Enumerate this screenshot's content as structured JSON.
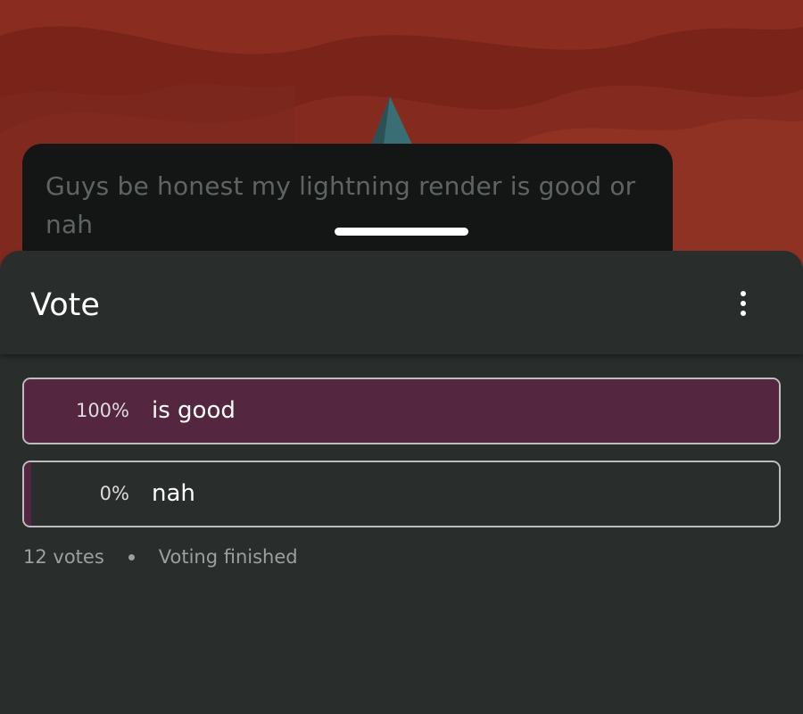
{
  "post": {
    "text": "Guys be honest my lightning render is good or nah"
  },
  "sheet": {
    "title": "Vote",
    "menu_icon": "more-vert-icon"
  },
  "poll": {
    "options": [
      {
        "percent_label": "100%",
        "label": "is good",
        "share": 1.0
      },
      {
        "percent_label": "0%",
        "label": "nah",
        "share": 0.0
      }
    ],
    "votes": "12 votes",
    "status": "Voting finished"
  },
  "colors": {
    "background": "#7a2419",
    "card": "#141616",
    "sheet": "#292d2c",
    "bar_fill": "#552640",
    "border": "#bdbdbd"
  }
}
